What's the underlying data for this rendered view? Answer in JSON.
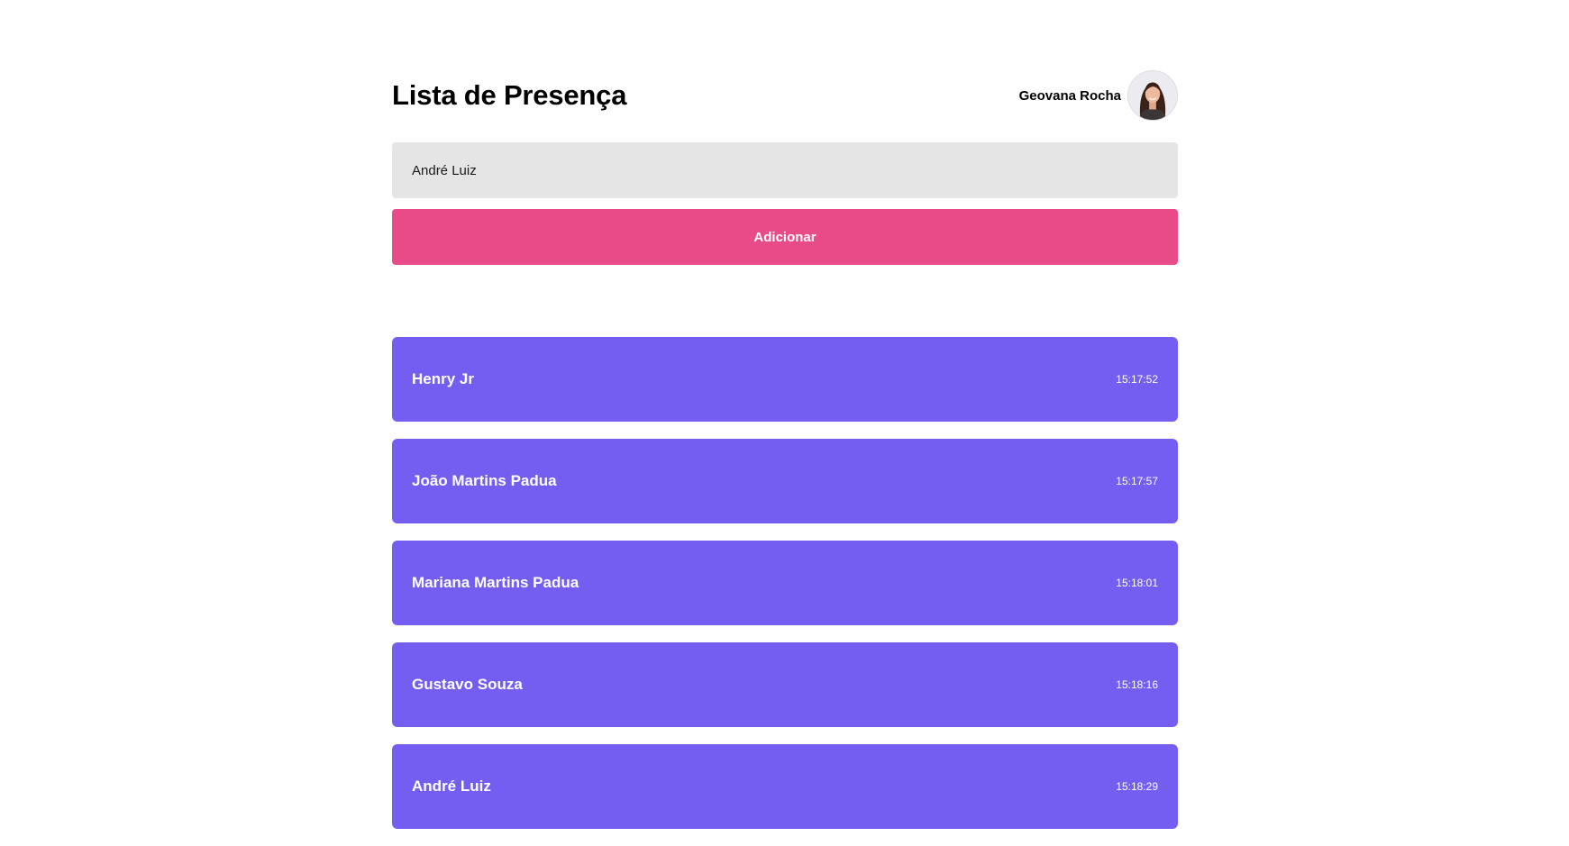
{
  "page": {
    "title": "Lista de Presença"
  },
  "user": {
    "name": "Geovana Rocha",
    "avatar_icon": "user-photo"
  },
  "form": {
    "input_value": "André Luiz",
    "button_label": "Adicionar"
  },
  "colors": {
    "button": "#e94b89",
    "card": "#745ef2",
    "input": "#e5e5e5"
  },
  "students": [
    {
      "name": "Henry Jr",
      "time": "15:17:52"
    },
    {
      "name": "João Martins Padua",
      "time": "15:17:57"
    },
    {
      "name": "Mariana Martins Padua",
      "time": "15:18:01"
    },
    {
      "name": "Gustavo Souza",
      "time": "15:18:16"
    },
    {
      "name": "André Luiz",
      "time": "15:18:29"
    }
  ]
}
